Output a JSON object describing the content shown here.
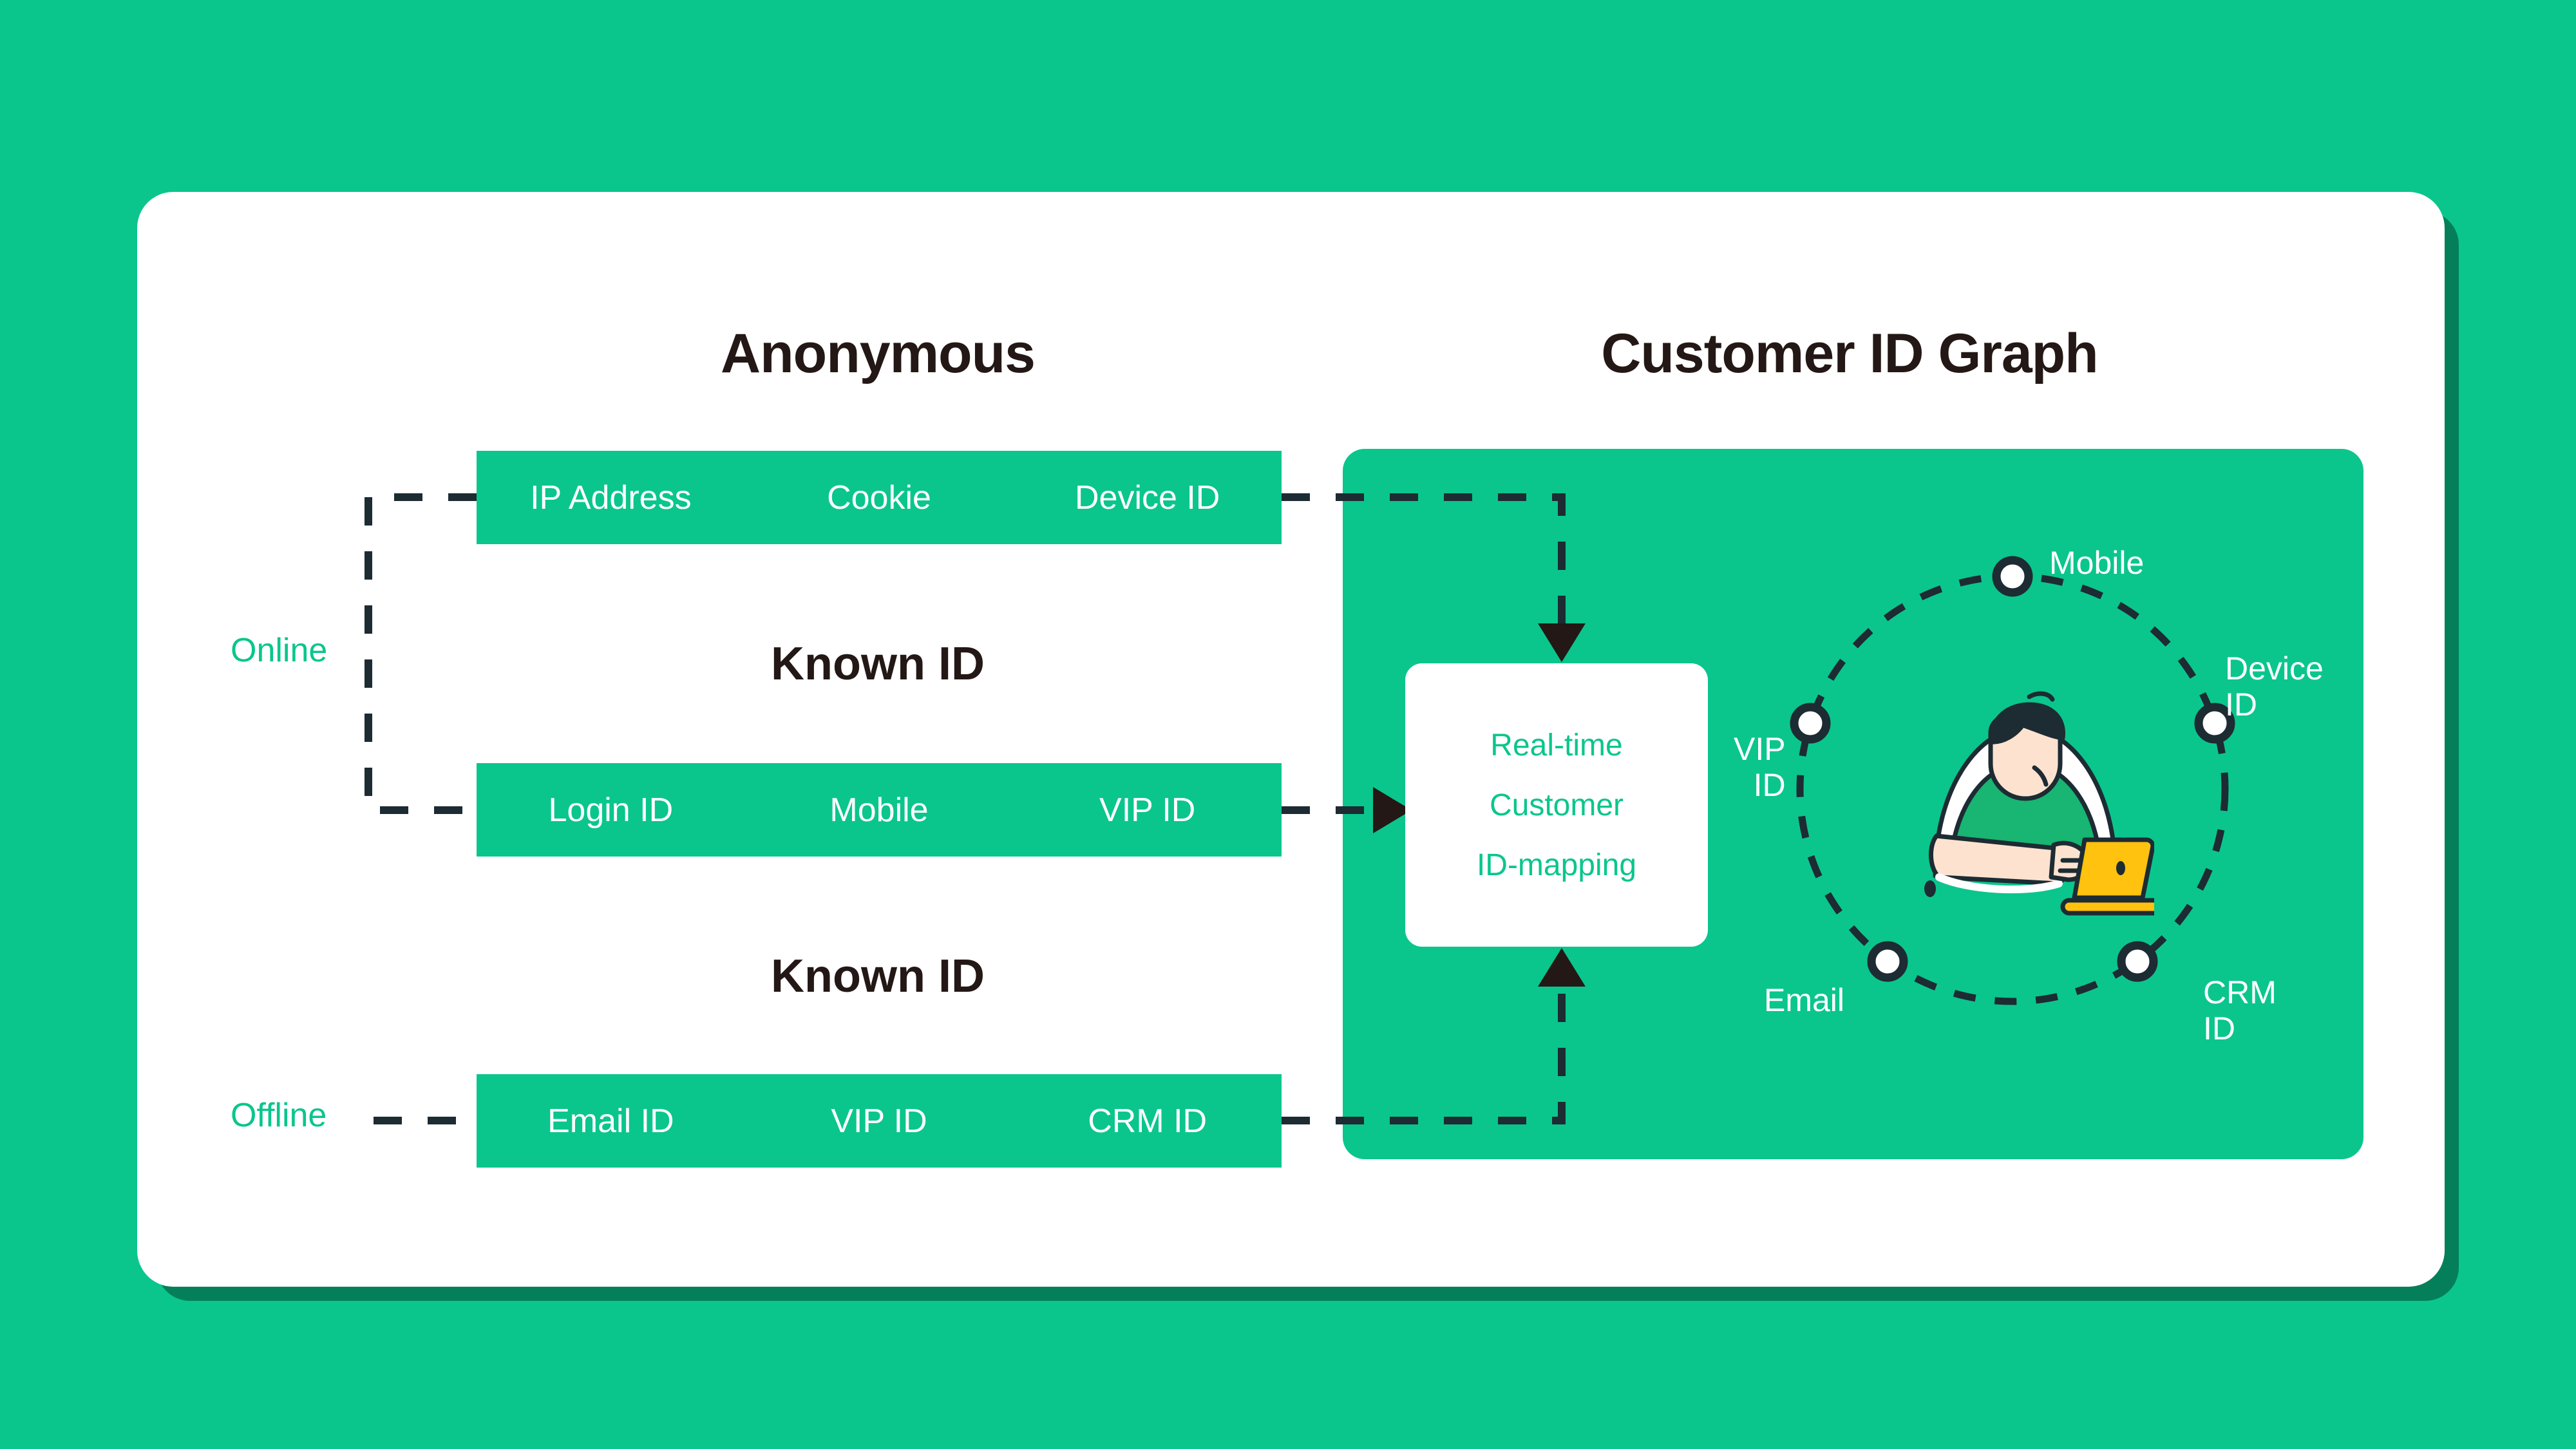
{
  "theme": {
    "background": "#0ac68c",
    "card_background": "#ffffff",
    "accent": "#0ac68c",
    "heading_color": "#231815",
    "line_color": "#1d2b33",
    "node_fill": "#ffffff",
    "laptop_color": "#ffc20e",
    "skin_color": "#fde3cf",
    "hair_color": "#1d2b33"
  },
  "headings": {
    "anonymous": "Anonymous",
    "customer_id_graph": "Customer ID Graph",
    "known_id_online": "Known ID",
    "known_id_offline": "Known ID"
  },
  "side_labels": {
    "online": "Online",
    "offline": "Offline"
  },
  "id_bars": [
    {
      "key": "anonymous",
      "cells": [
        "IP Address",
        "Cookie",
        "Device ID"
      ]
    },
    {
      "key": "known_online",
      "cells": [
        "Login ID",
        "Mobile",
        "VIP ID"
      ]
    },
    {
      "key": "known_offline",
      "cells": [
        "Email ID",
        "VIP ID",
        "CRM ID"
      ]
    }
  ],
  "mapping_box": {
    "lines": [
      "Real-time",
      "Customer",
      "ID-mapping"
    ]
  },
  "graph_nodes": [
    {
      "key": "mobile",
      "label": "Mobile"
    },
    {
      "key": "device_id",
      "label": "Device\nID"
    },
    {
      "key": "vip_id",
      "label": "VIP\nID"
    },
    {
      "key": "email",
      "label": "Email"
    },
    {
      "key": "crm_id",
      "label": "CRM\nID"
    }
  ]
}
